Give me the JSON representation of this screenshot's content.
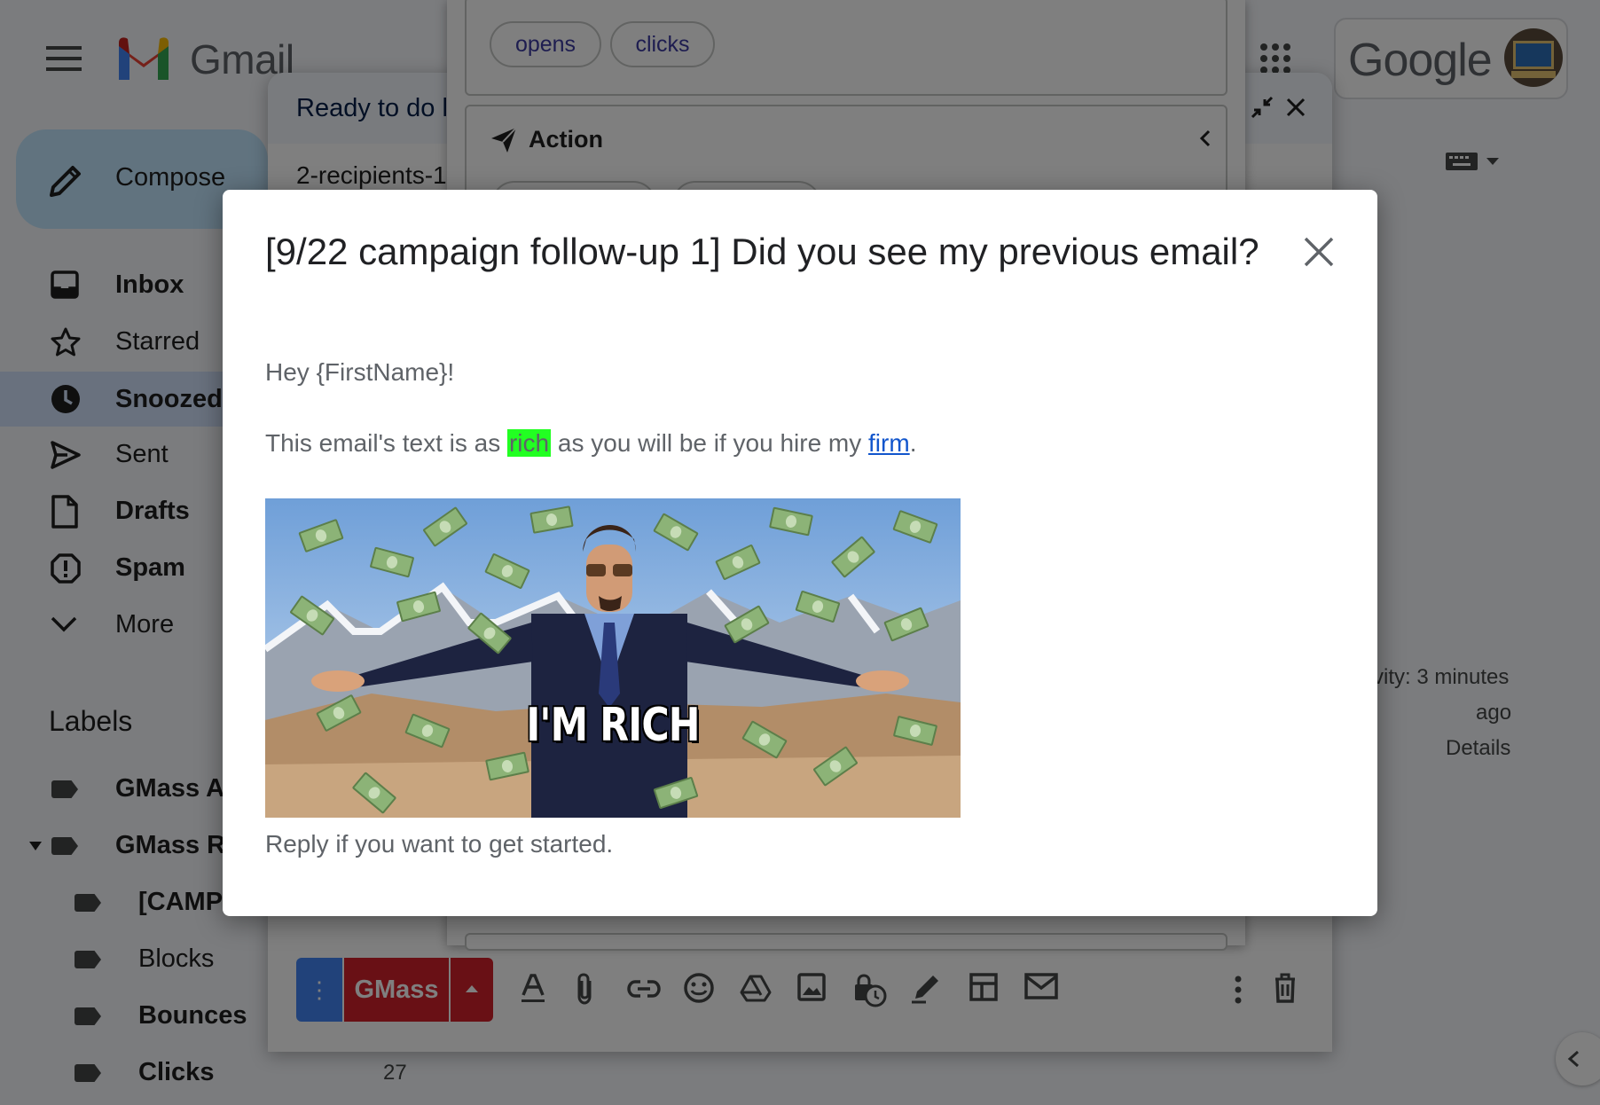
{
  "gmail": {
    "app_name": "Gmail",
    "google_wordmark": "Google",
    "compose_label": "Compose",
    "nav": [
      {
        "label": "Inbox",
        "icon": "inbox-icon",
        "bold": true
      },
      {
        "label": "Starred",
        "icon": "star-icon",
        "bold": false
      },
      {
        "label": "Snoozed",
        "icon": "clock-icon",
        "bold": true
      },
      {
        "label": "Sent",
        "icon": "send-icon",
        "bold": false
      },
      {
        "label": "Drafts",
        "icon": "file-icon",
        "bold": true
      },
      {
        "label": "Spam",
        "icon": "alert-icon",
        "bold": true
      },
      {
        "label": "More",
        "icon": "chevron-down-icon",
        "bold": false
      }
    ],
    "labels_heading": "Labels",
    "labels": [
      {
        "label": "GMass Au",
        "bold": true
      },
      {
        "label": "GMass Re",
        "bold": true
      },
      {
        "label": "[CAMP",
        "bold": true
      },
      {
        "label": "Blocks",
        "bold": false
      },
      {
        "label": "Bounces",
        "bold": true
      },
      {
        "label": "Clicks",
        "bold": true
      }
    ],
    "clicks_count": "27",
    "activity_line1": "vity: 3 minutes",
    "activity_line2": "ago",
    "details_link": "Details"
  },
  "compose": {
    "title": "Ready to do l",
    "recipients": "2-recipients-1",
    "gmass_label": "GMass",
    "more_dots": "⋮"
  },
  "settings_panel": {
    "tracking_chips": [
      "opens",
      "clicks"
    ],
    "action_title": "Action"
  },
  "modal": {
    "title": "[9/22 campaign follow-up 1] Did you see my previous email?",
    "greeting": "Hey {FirstName}!",
    "line_before": "This email's text is as ",
    "highlight": "rich",
    "line_middle": " as you will be if you hire my ",
    "link_text": "firm",
    "line_end": ".",
    "image_caption": "I'M RICH",
    "closing": "Reply if you want to get started."
  },
  "colors": {
    "highlight": "#22ff22",
    "link": "#1155cc",
    "gmass_red": "#d3202a",
    "gmass_blue": "#4285f4",
    "chip_text": "#3c3aa0"
  }
}
